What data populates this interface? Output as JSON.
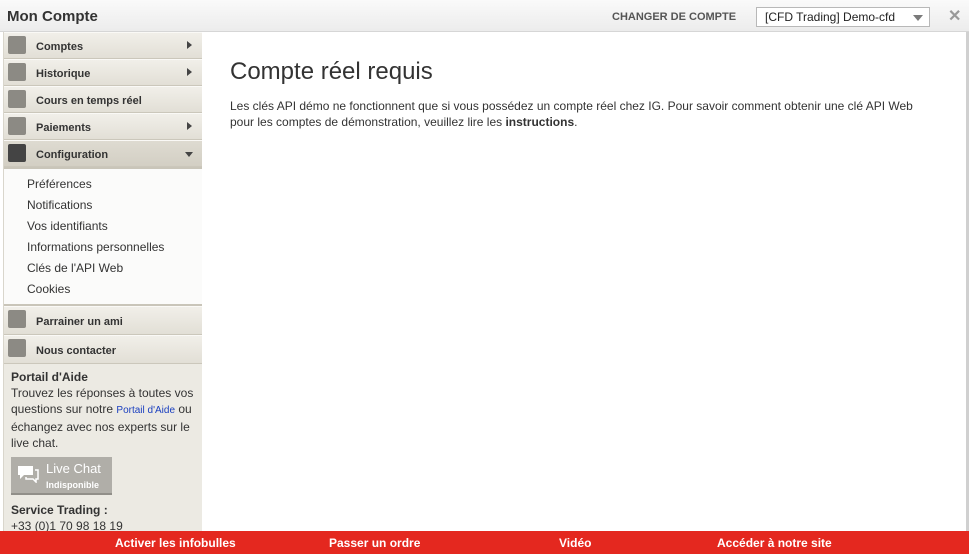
{
  "window": {
    "title": "Mon Compte",
    "close_glyph": "✕"
  },
  "account_switch": {
    "label": "CHANGER DE COMPTE",
    "selected": "[CFD Trading]  Demo-cfd"
  },
  "sidebar": {
    "items": [
      {
        "label": "Comptes",
        "icon": "user-icon"
      },
      {
        "label": "Historique",
        "icon": "history-icon"
      },
      {
        "label": "Cours en temps réel",
        "icon": "filter-icon"
      },
      {
        "label": "Paiements",
        "icon": "card-icon"
      },
      {
        "label": "Configuration",
        "icon": "gear-icon"
      }
    ],
    "submenu": [
      "Préférences",
      "Notifications",
      "Vos identifiants",
      "Informations personnelles",
      "Clés de l'API Web",
      "Cookies"
    ],
    "bottom_items": [
      {
        "label": "Parrainer un ami",
        "icon": "users-icon"
      },
      {
        "label": "Nous contacter",
        "icon": "chat-icon"
      }
    ],
    "help": {
      "title": "Portail d'Aide",
      "text_before": "Trouvez les réponses à toutes vos questions sur notre ",
      "link": "Portail d'Aide",
      "text_after": " ou échangez avec nos experts sur le live chat."
    },
    "live_chat": {
      "title": "Live Chat",
      "status": "Indisponible"
    },
    "service": {
      "title": "Service Trading :",
      "phone": "+33 (0)1 70 98 18 19"
    }
  },
  "main": {
    "title": "Compte réel requis",
    "text": "Les clés API démo ne fonctionnent que si vous possédez un compte réel chez IG. Pour savoir comment obtenir une clé API Web pour les comptes de démonstration, veuillez lire les ",
    "link": "instructions",
    "text_end": "."
  },
  "bottom_bar": {
    "tooltips": "Activer les infobulles",
    "order": "Passer un ordre",
    "video": "Vidéo",
    "site": "Accéder à notre site"
  },
  "colors": {
    "accent": "#e4281f",
    "link": "#1a3fbf",
    "sidebar_bg": "#eceae3"
  }
}
